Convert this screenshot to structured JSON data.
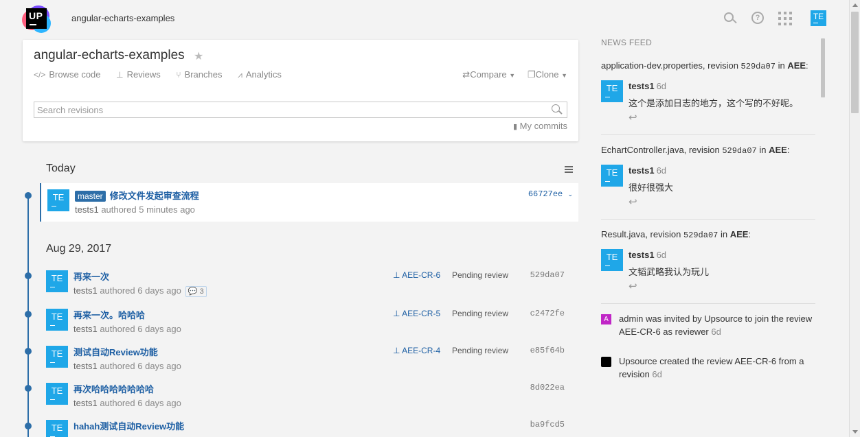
{
  "header": {
    "app_title": "angular-echarts-examples",
    "logo_text": "UP",
    "user_initials": "TE"
  },
  "project": {
    "title": "angular-echarts-examples",
    "nav": {
      "browse_code": "Browse code",
      "reviews": "Reviews",
      "branches": "Branches",
      "analytics": "Analytics",
      "compare": "Compare",
      "clone": "Clone"
    },
    "search_placeholder": "Search revisions",
    "my_commits": "My commits"
  },
  "timeline": {
    "groups": [
      {
        "date": "Today",
        "revisions": [
          {
            "initials": "TE",
            "branch": "master",
            "title": "修改文件发起审查流程",
            "author": "tests1",
            "authored": "authored 5 minutes ago",
            "hash": "66727ee"
          }
        ]
      },
      {
        "date": "Aug 29, 2017",
        "revisions": [
          {
            "initials": "TE",
            "title": "再来一次",
            "author": "tests1",
            "authored": "authored 6 days ago",
            "comments": "3",
            "review": "AEE-CR-6",
            "status": "Pending review",
            "hash": "529da07"
          },
          {
            "initials": "TE",
            "title": "再来一次。哈哈哈",
            "author": "tests1",
            "authored": "authored 6 days ago",
            "review": "AEE-CR-5",
            "status": "Pending review",
            "hash": "c2472fe"
          },
          {
            "initials": "TE",
            "title": "测试自动Review功能",
            "author": "tests1",
            "authored": "authored 6 days ago",
            "review": "AEE-CR-4",
            "status": "Pending review",
            "hash": "e85f64b"
          },
          {
            "initials": "TE",
            "title": "再次哈哈哈哈哈哈哈",
            "author": "tests1",
            "authored": "authored 6 days ago",
            "hash": "8d022ea"
          },
          {
            "initials": "TE",
            "title": "hahah测试自动Review功能",
            "author": "",
            "authored": "",
            "hash": "ba9fcd5"
          }
        ]
      }
    ]
  },
  "feed": {
    "heading": "NEWS FEED",
    "entries": [
      {
        "file": "application-dev.properties",
        "rev_prefix": ", revision ",
        "revision": "529da07",
        "in": " in ",
        "project": "AEE",
        "suffix": ":",
        "initials": "TE",
        "user": "tests1",
        "time": "6d",
        "message": "这个是添加日志的地方，这个写的不好呢。"
      },
      {
        "file": "EchartController.java",
        "rev_prefix": ", revision ",
        "revision": "529da07",
        "in": " in ",
        "project": "AEE",
        "suffix": ":",
        "initials": "TE",
        "user": "tests1",
        "time": "6d",
        "message": "很好很强大"
      },
      {
        "file": "Result.java",
        "rev_prefix": ", revision ",
        "revision": "529da07",
        "in": " in ",
        "project": "AEE",
        "suffix": ":",
        "initials": "TE",
        "user": "tests1",
        "time": "6d",
        "message": "文韬武略我认为玩儿"
      }
    ],
    "events": [
      {
        "icon_letter": "A",
        "text": "admin was invited by Upsource to join the review AEE-CR-6 as reviewer",
        "time": "6d"
      },
      {
        "icon_letter": "UP",
        "text": "Upsource created the review AEE-CR-6 from a revision",
        "time": "6d"
      }
    ]
  },
  "colors": {
    "accent": "#2d6ea8",
    "link": "#1c5ea3",
    "avatar": "#1fa7e8",
    "page_bg": "#f3f3f3"
  }
}
